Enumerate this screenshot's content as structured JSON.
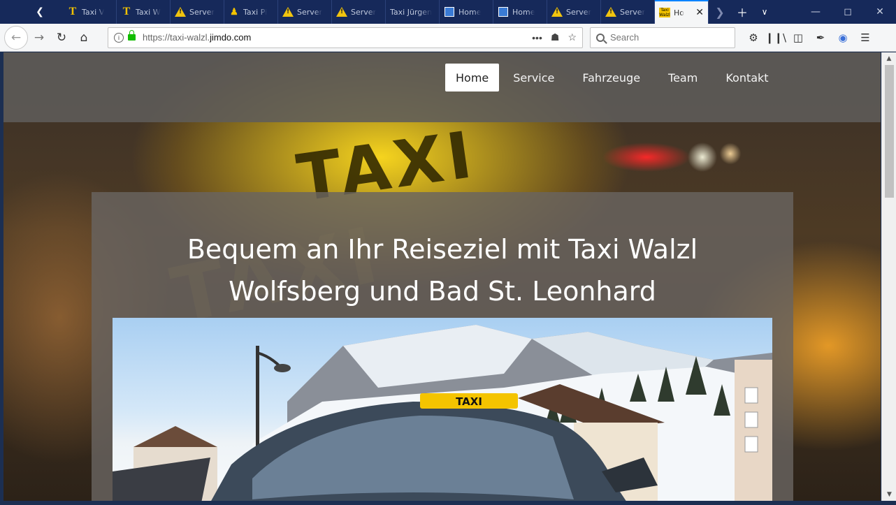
{
  "browser": {
    "tabs": [
      {
        "label": "Taxi V",
        "icon": "taxi-t-icon",
        "active": false
      },
      {
        "label": "Taxi W",
        "icon": "taxi-t-icon",
        "active": false
      },
      {
        "label": "Server",
        "icon": "warning-icon",
        "active": false
      },
      {
        "label": "Taxi Pi",
        "icon": "taxi-person-icon",
        "active": false
      },
      {
        "label": "Server",
        "icon": "warning-icon",
        "active": false
      },
      {
        "label": "Server",
        "icon": "warning-icon",
        "active": false
      },
      {
        "label": "Taxi Jürgen",
        "icon": "none",
        "active": false
      },
      {
        "label": "Home",
        "icon": "page-icon",
        "active": false
      },
      {
        "label": "Home",
        "icon": "page-icon",
        "active": false
      },
      {
        "label": "Server",
        "icon": "warning-icon",
        "active": false
      },
      {
        "label": "Server",
        "icon": "warning-icon",
        "active": false
      },
      {
        "label": "Ho",
        "icon": "taxi-favicon",
        "active": true
      }
    ],
    "url_prefix": "https://taxi-walzl.",
    "url_domain": "jimdo.com",
    "search_placeholder": "Search",
    "accent_color": "#0a84ff"
  },
  "site": {
    "menu": [
      {
        "label": "Home",
        "active": true
      },
      {
        "label": "Service",
        "active": false
      },
      {
        "label": "Fahrzeuge",
        "active": false
      },
      {
        "label": "Team",
        "active": false
      },
      {
        "label": "Kontakt",
        "active": false
      }
    ],
    "headline_line1": "Bequem an Ihr Reiseziel mit Taxi Walzl",
    "headline_line2": "Wolfsberg und Bad St. Leonhard",
    "hero_taxi_sign": "TAXI",
    "photo_taxi_sign": "TAXI"
  }
}
